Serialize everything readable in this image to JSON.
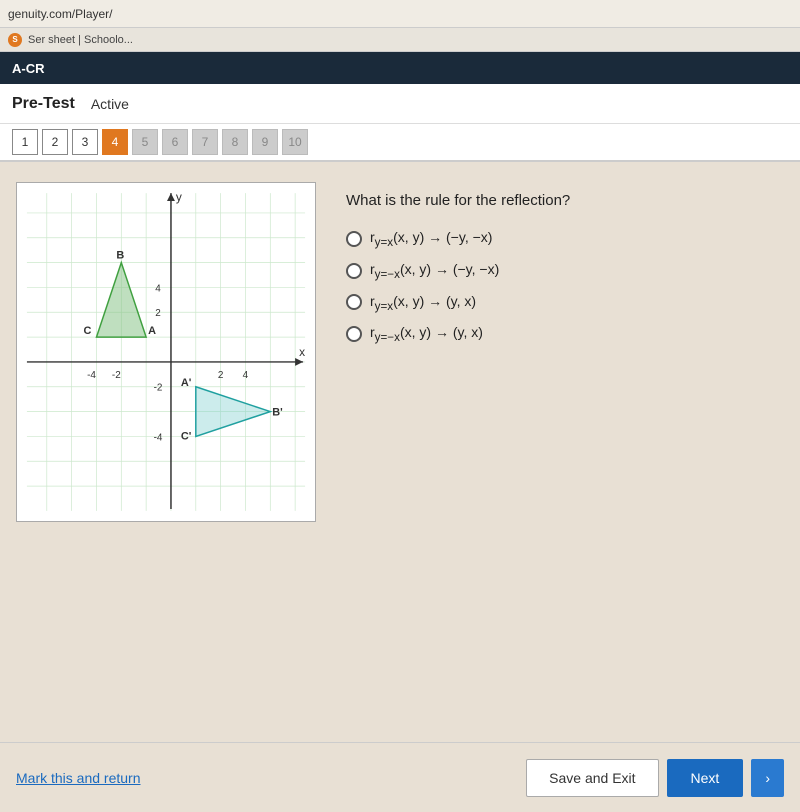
{
  "browser": {
    "url": "genuity.com/Player/",
    "tab_text": "Ser sheet | Schoolo..."
  },
  "header": {
    "title": "A-CR"
  },
  "pretest": {
    "title": "Pre-Test",
    "status": "Active"
  },
  "question_nav": {
    "buttons": [
      "1",
      "2",
      "3",
      "4",
      "5",
      "6",
      "7",
      "8",
      "9",
      "10"
    ],
    "active_index": 3
  },
  "question": {
    "text": "What is the rule for the reflection?",
    "options": [
      {
        "id": "opt1",
        "label": "rᵧ=x(x, y) → (−y, −x)"
      },
      {
        "id": "opt2",
        "label": "rᵧ=−x(x, y) → (−y, −x)"
      },
      {
        "id": "opt3",
        "label": "rᵧ=x(x, y) → (y, x)"
      },
      {
        "id": "opt4",
        "label": "rᵧ=−x(x, y) → (y, x)"
      }
    ]
  },
  "footer": {
    "mark_return_label": "Mark this and return",
    "save_exit_label": "Save and Exit",
    "next_label": "Next"
  },
  "graph": {
    "labels": {
      "x_axis": "x",
      "y_axis": "y",
      "points_original": [
        "B",
        "A",
        "C"
      ],
      "points_reflected": [
        "A'",
        "B'",
        "C'"
      ]
    }
  }
}
